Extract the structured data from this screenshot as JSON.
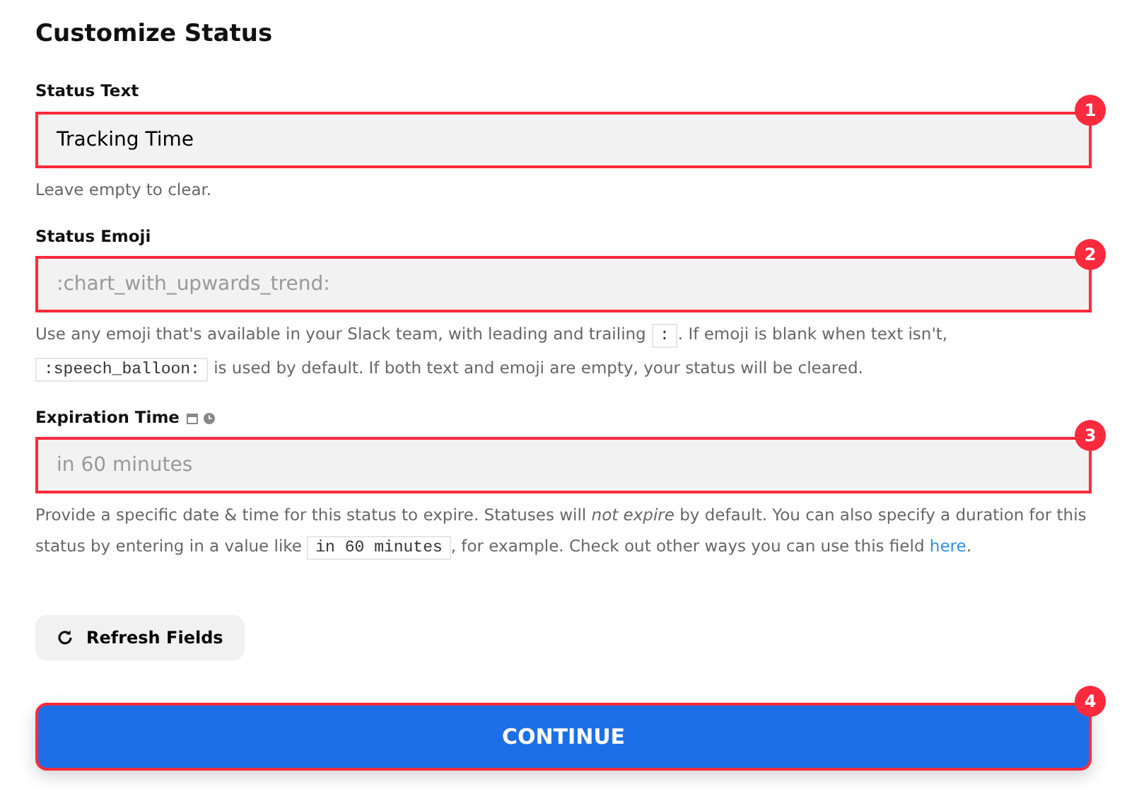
{
  "title": "Customize Status",
  "fields": [
    {
      "label": "Status Text",
      "value": "Tracking Time",
      "marker": "1",
      "label_icons": false,
      "help": [
        {
          "kind": "text",
          "text": "Leave empty to clear."
        }
      ]
    },
    {
      "label": "Status Emoji",
      "placeholder": ":chart_with_upwards_trend:",
      "marker": "2",
      "label_icons": false,
      "help": [
        {
          "kind": "text",
          "text": "Use any emoji that's available in your Slack team, with leading and trailing "
        },
        {
          "kind": "code",
          "text": ":"
        },
        {
          "kind": "text",
          "text": ". If emoji is blank when text isn't, "
        },
        {
          "kind": "code",
          "text": ":speech_balloon:"
        },
        {
          "kind": "text",
          "text": " is used by default. If both text and emoji are empty, your status will be cleared."
        }
      ]
    },
    {
      "label": "Expiration Time",
      "placeholder": "in 60 minutes",
      "marker": "3",
      "label_icons": true,
      "help": [
        {
          "kind": "text",
          "text": "Provide a specific date & time for this status to expire. Statuses will *not expire* by default. You can also specify a duration for this status by entering in a value like "
        },
        {
          "kind": "code",
          "text": "in 60 minutes"
        },
        {
          "kind": "text",
          "text": ", for example. Check out other ways you can use this field "
        },
        {
          "kind": "link",
          "text": "here"
        },
        {
          "kind": "text",
          "text": "."
        }
      ]
    }
  ],
  "refresh_button": "Refresh Fields",
  "continue_button": {
    "label": "CONTINUE",
    "marker": "4"
  }
}
